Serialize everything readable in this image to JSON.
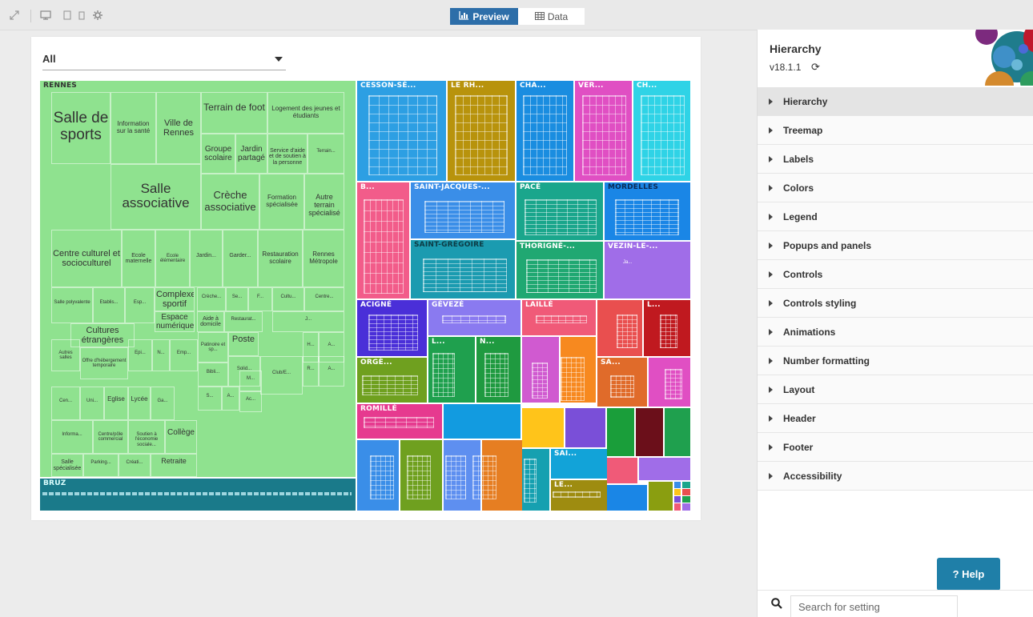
{
  "toolbar": {
    "icons": [
      "expand-icon",
      "desktop-icon",
      "tablet-icon",
      "phone-icon",
      "settings-gear-icon"
    ],
    "tabs": [
      {
        "label": "Preview",
        "icon": "chart-icon",
        "active": true
      },
      {
        "label": "Data",
        "icon": "table-icon",
        "active": false
      }
    ]
  },
  "filter": {
    "value": "All"
  },
  "treemap": {
    "colors": {
      "rennes": "#8fe28f",
      "bruz": "#1a7a8a",
      "cesson": "#2d9fe3",
      "lerh": "#b8930c",
      "cha": "#1a8de0",
      "ver": "#e04fc3",
      "ch": "#2fd3e6",
      "b": "#f25c8a",
      "saintjacques": "#3a8ee8",
      "pace": "#1aa68c",
      "mordelles": "#1a86e6",
      "saintgregoire": "#1b9bb0",
      "thorigne": "#20a872",
      "vezin": "#a06de8",
      "acigne": "#4a2fd8",
      "gevese": "#8a7af0",
      "laille": "#f05a78",
      "orge": "#6fa01f",
      "romille": "#e63a8f"
    },
    "groups": {
      "rennes": "RENNES",
      "bruz": "BRUZ",
      "cesson": "CESSON-SÉ...",
      "lerh": "LE RH...",
      "cha": "CHA...",
      "ver": "VER...",
      "ch": "CH...",
      "b": "B...",
      "saintjacques": "SAINT-JACQUES-...",
      "pace": "PACÉ",
      "mordelles": "MORDELLES",
      "saintgregoire": "SAINT-GRÉGOIRE",
      "thorigne": "THORIGNÉ-...",
      "vezin": "VEZIN-LE-...",
      "vezin_sub": "Ja...",
      "acigne": "ACIGNÉ",
      "gevese": "GÉVEZÉ",
      "laille": "LAILLÉ",
      "l_small": "L...",
      "l_green": "L...",
      "n_green": "N...",
      "orge": "ORGÈ...",
      "sa": "SA...",
      "romille": "ROMILLÉ",
      "sai": "SAI...",
      "le": "LE..."
    },
    "rennes_cells": {
      "salle_sports": "Salle de sports",
      "info_sante": "Information sur la santé",
      "ville_rennes": "Ville de Rennes",
      "terrain_foot": "Terrain de foot",
      "logement": "Logement des jeunes et étudiants",
      "groupe_scolaire": "Groupe scolaire",
      "jardin_partage": "Jardin partagé",
      "service_aide": "Service d'aide et de soutien à la personne",
      "terrain_short": "Terrain...",
      "salle_assoc": "Salle associative",
      "creche_assoc": "Crèche associative",
      "formation": "Formation spécialisée",
      "autre_terrain": "Autre terrain spécialisé",
      "centre_culturel": "Centre culturel et socioculturel",
      "ecole_mat": "Ecole maternelle",
      "ecole_elem": "Ecole élémentaire",
      "jardin_short": "Jardin...",
      "garder": "Garder...",
      "restauration": "Restauration scolaire",
      "rennes_metro": "Rennes Métropole",
      "salle_poly": "Salle polyvalente",
      "etablis": "Etablis...",
      "esp": "Esp...",
      "complexe": "Complexe sportif",
      "creche_short": "Crèche...",
      "se": "Se...",
      "f": "F...",
      "cultu": "Cultu...",
      "centre_short": "Centre...",
      "espace_num": "Espace numérique",
      "aide_domicile": "Aide à domicile",
      "restaurat": "Restaurat...",
      "j": "J...",
      "cultures": "Cultures étrangères",
      "autres_salles": "Autres salles",
      "offre_heberg": "Offre d'hébergement temporaire",
      "epi": "Epi...",
      "n": "N...",
      "emp": "Emp...",
      "patinoire": "Patinoire et sp...",
      "poste": "Poste",
      "h": "H...",
      "a": "A...",
      "bibli": "Bibli...",
      "solid": "Solid...",
      "club": "Club/E...",
      "r": "R...",
      "a2": "A...",
      "s": "S...",
      "a3": "A...",
      "m": "M...",
      "ac": "Ac...",
      "cen": "Cen...",
      "uni": "Uni...",
      "eglise": "Eglise",
      "lycee": "Lycée",
      "ga": "Ga...",
      "informa": "Informa...",
      "centre_pole": "Centre/pôle commercial",
      "soutien_eco": "Soutien à l'économie sociale...",
      "college": "Collège",
      "salle_spec": "Salle spécialisée",
      "parking": "Parking...",
      "creati": "Créati...",
      "retraite": "Retraite"
    }
  },
  "panel": {
    "title": "Hierarchy",
    "version": "v18.1.1",
    "menu": [
      "Hierarchy",
      "Treemap",
      "Labels",
      "Colors",
      "Legend",
      "Popups and panels",
      "Controls",
      "Controls styling",
      "Animations",
      "Number formatting",
      "Layout",
      "Header",
      "Footer",
      "Accessibility"
    ],
    "help_label": "? Help",
    "search_placeholder": "Search for setting"
  }
}
